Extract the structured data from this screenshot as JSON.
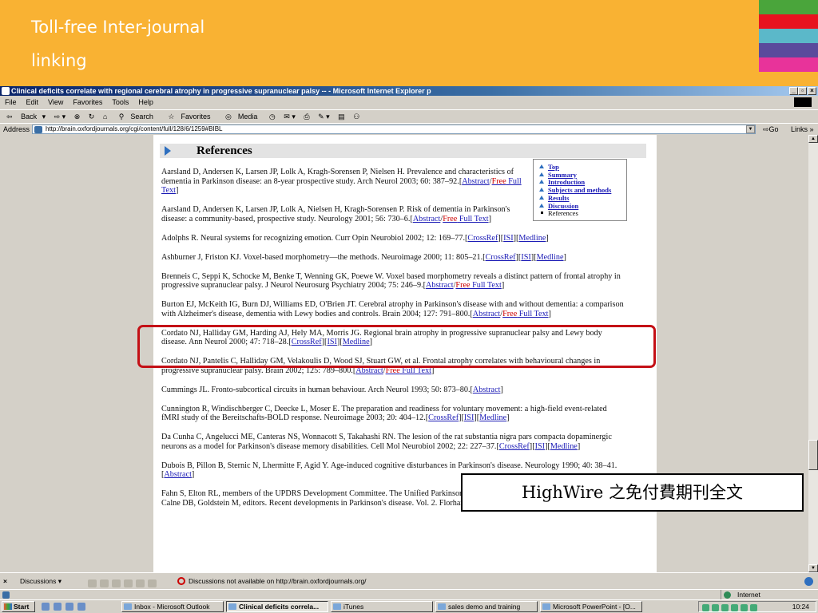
{
  "slide": {
    "title_line1": "Toll-free Inter-journal",
    "title_line2": "linking",
    "header_color": "#f9b233",
    "stripe_colors": [
      "#4aa53b",
      "#e8131f",
      "#5bb8c9",
      "#5a4a9c",
      "#e8339a",
      "#f9b233"
    ]
  },
  "window": {
    "title": "Clinical deficits correlate with regional cerebral atrophy in progressive supranuclear palsy -- - Microsoft Internet Explorer p",
    "menu": [
      "File",
      "Edit",
      "View",
      "Favorites",
      "Tools",
      "Help"
    ],
    "toolbar": {
      "back": "Back",
      "search": "Search",
      "favorites": "Favorites",
      "media": "Media"
    },
    "address": {
      "label": "Address",
      "url": "http://brain.oxfordjournals.org/cgi/content/full/128/6/1259#BIBL",
      "go": "Go",
      "links": "Links"
    }
  },
  "page": {
    "heading": "References",
    "toc": {
      "items": [
        "Top",
        "Summary",
        "Introduction",
        "Subjects and methods",
        "Results",
        "Discussion"
      ],
      "current": "References"
    },
    "link_sep": "/",
    "references": [
      {
        "text": "Aarsland D, Andersen K, Larsen JP, Lolk A, Kragh-Sorensen P, Nielsen H. Prevalence and characteristics of dementia in Parkinson disease: an 8-year prospective study. Arch Neurol 2003; 60: 387–92.",
        "links": [
          "Abstract"
        ],
        "free": "Free Full Text"
      },
      {
        "text": "Aarsland D, Andersen K, Larsen JP, Lolk A, Nielsen H, Kragh-Sorensen P. Risk of dementia in Parkinson's disease: a community-based, prospective study. Neurology 2001; 56: 730–6.",
        "links": [
          "Abstract"
        ],
        "free": "Free Full Text"
      },
      {
        "text": "Adolphs R. Neural systems for recognizing emotion. Curr Opin Neurobiol 2002; 12: 169–77.",
        "links": [
          "CrossRef",
          "ISI",
          "Medline"
        ]
      },
      {
        "text": "Ashburner J, Friston KJ. Voxel-based morphometry—the methods. Neuroimage 2000; 11: 805–21.",
        "links": [
          "CrossRef",
          "ISI",
          "Medline"
        ]
      },
      {
        "text": "Brenneis C, Seppi K, Schocke M, Benke T, Wenning GK, Poewe W. Voxel based morphometry reveals a distinct pattern of frontal atrophy in progressive supranuclear palsy. J Neurol Neurosurg Psychiatry 2004; 75: 246–9.",
        "links": [
          "Abstract"
        ],
        "free": "Free Full Text"
      },
      {
        "text": "Burton EJ, McKeith IG, Burn DJ, Williams ED, O'Brien JT. Cerebral atrophy in Parkinson's disease with and without dementia: a comparison with Alzheimer's disease, dementia with Lewy bodies and controls. Brain 2004; 127: 791–800.",
        "links": [
          "Abstract"
        ],
        "free": "Free Full Text"
      },
      {
        "text": "Cordato NJ, Halliday GM, Harding AJ, Hely MA, Morris JG. Regional brain atrophy in progressive supranuclear palsy and Lewy body disease. Ann Neurol 2000; 47: 718–28.",
        "links": [
          "CrossRef",
          "ISI",
          "Medline"
        ]
      },
      {
        "text": "Cordato NJ, Pantelis C, Halliday GM, Velakoulis D, Wood SJ, Stuart GW, et al. Frontal atrophy correlates with behavioural changes in progressive supranuclear palsy. Brain 2002; 125: 789–800.",
        "links": [
          "Abstract"
        ],
        "free": "Free Full Text"
      },
      {
        "text": "Cummings JL. Fronto-subcortical circuits in human behaviour. Arch Neurol 1993; 50: 873–80.",
        "links": [
          "Abstract"
        ]
      },
      {
        "text": "Cunnington R, Windischberger C, Deecke L, Moser E. The preparation and readiness for voluntary movement: a high-field event-related fMRI study of the Bereitschafts-BOLD response. Neuroimage 2003; 20: 404–12.",
        "links": [
          "CrossRef",
          "ISI",
          "Medline"
        ]
      },
      {
        "text": "Da Cunha C, Angelucci ME, Canteras NS, Wonnacott S, Takahashi RN. The lesion of the rat substantia nigra pars compacta dopaminergic neurons as a model for Parkinson's disease memory disabilities. Cell Mol Neurobiol 2002; 22: 227–37.",
        "links": [
          "CrossRef",
          "ISI",
          "Medline"
        ]
      },
      {
        "text": "Dubois B, Pillon B, Sternic N, Lhermitte F, Agid Y. Age-induced cognitive disturbances in Parkinson's disease. Neurology 1990; 40: 38–41.",
        "links": [
          "Abstract"
        ]
      },
      {
        "text": "Fahn S, Elton RL, members of the UPDRS Development Committee. The Unified Parkinson's Disease Rating Scale. In: Fahn S, Marsden CD, Calne DB, Goldstein M, editors. Recent developments in Parkinson's disease. Vol. 2. Florham"
      }
    ],
    "highlight_color": "#c41016"
  },
  "callout": "HighWire 之免付費期刊全文",
  "discussions": {
    "label": "Discussions ▾",
    "message": "Discussions not available on http://brain.oxfordjournals.org/"
  },
  "statusbar": {
    "zone": "Internet"
  },
  "taskbar": {
    "start": "Start",
    "tasks": [
      "Inbox - Microsoft Outlook",
      "Clinical deficits correla...",
      "iTunes",
      "sales demo and training",
      "Microsoft PowerPoint - [O..."
    ],
    "clock": "10:24"
  }
}
